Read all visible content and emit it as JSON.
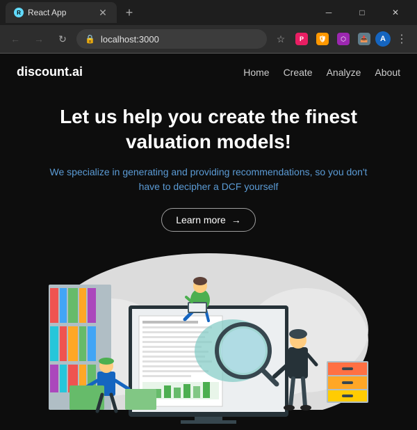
{
  "browser": {
    "tab_title": "React App",
    "tab_favicon": "R",
    "new_tab_label": "+",
    "url": "localhost:3000",
    "window_controls": {
      "minimize": "─",
      "maximize": "□",
      "close": "✕"
    },
    "nav": {
      "back": "←",
      "forward": "→",
      "refresh": "↻"
    },
    "toolbar_icons": [
      "★",
      "🔲",
      "🛡",
      "⬡",
      "📥",
      "⋮"
    ]
  },
  "site": {
    "logo": "discount.ai",
    "nav_links": [
      "Home",
      "Create",
      "Analyze",
      "About"
    ],
    "hero": {
      "title": "Let us help you create the finest valuation models!",
      "subtitle": "We specialize in generating and providing recommendations, so you don't have to decipher a DCF yourself",
      "cta_label": "Learn more",
      "cta_arrow": "→"
    }
  },
  "colors": {
    "background": "#0d0d0d",
    "accent_blue": "#5b9bd5",
    "nav_bg": "#2d2d2d",
    "white": "#ffffff",
    "cloud": "#f0f0f0",
    "green_figure": "#4caf50",
    "teal_figure": "#26a69a"
  }
}
